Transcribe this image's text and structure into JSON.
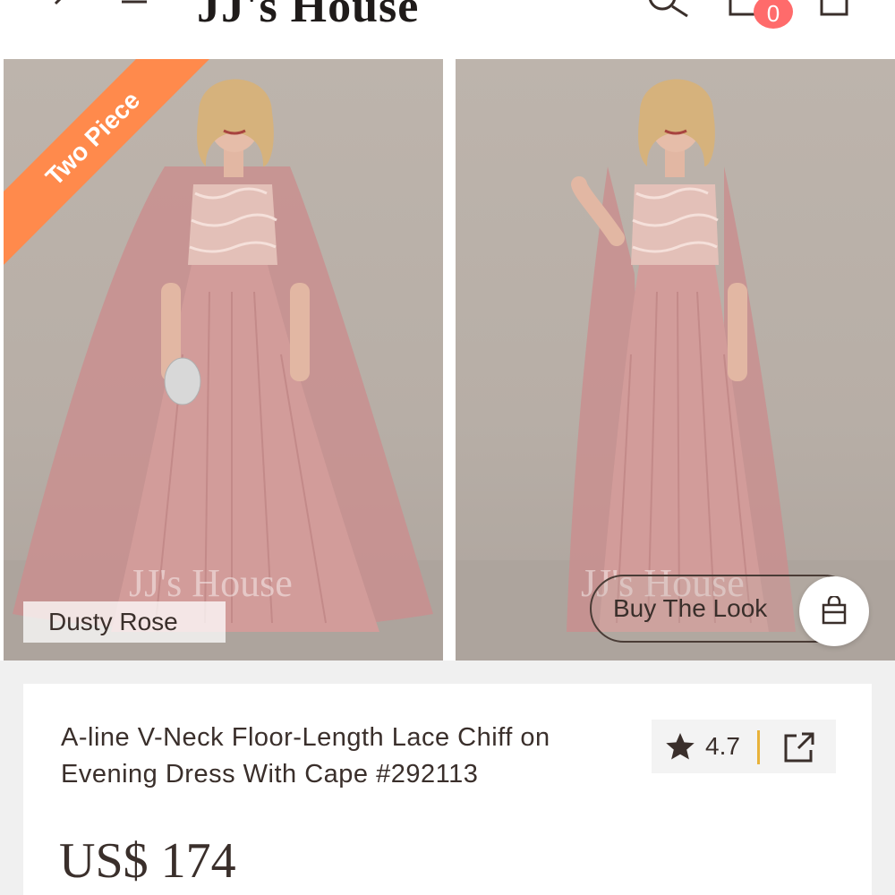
{
  "header": {
    "logo": "JJ's House",
    "cart_count": "0",
    "icons": [
      "back-arrow-icon",
      "menu-icon",
      "search-icon",
      "cart-icon",
      "bag-icon"
    ]
  },
  "gallery": {
    "ribbon": "Two Piece",
    "watermark": "JJ's House",
    "color_label": "Dusty Rose",
    "look_button": "Buy The Look"
  },
  "product": {
    "title": "A-line V-Neck Floor-Length Lace Chiff on Evening Dress With Cape #292113",
    "rating": "4.7",
    "price": "US$ 174"
  },
  "colors": {
    "ribbon": "#ff8a4c",
    "badge": "#ff6b6b",
    "dress": "#c98f8f",
    "background": "#b9b0a8",
    "rating_divider": "#e8b23a"
  }
}
